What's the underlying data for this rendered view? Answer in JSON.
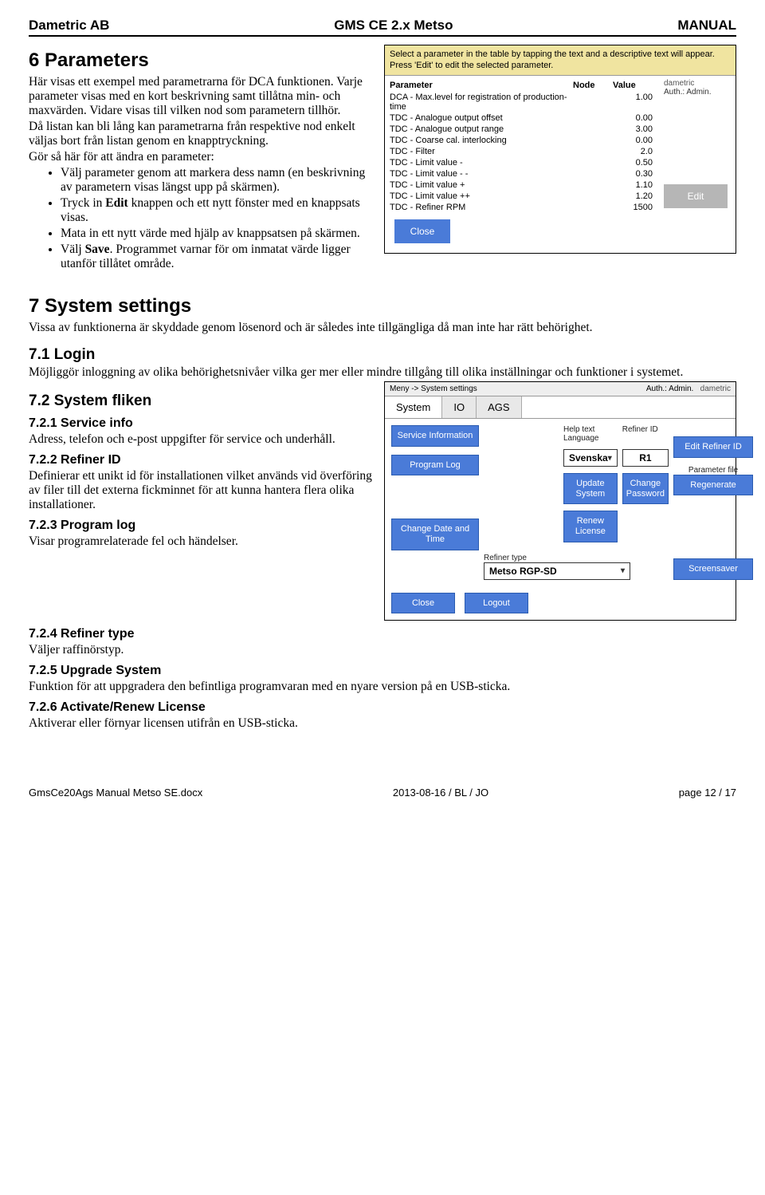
{
  "header": {
    "left": "Dametric AB",
    "center": "GMS CE 2.x Metso",
    "right": "MANUAL"
  },
  "sec6": {
    "title": "6   Parameters",
    "p1": "Här visas ett exempel med parametrarna för DCA funktionen. Varje parameter visas med en kort beskrivning samt tillåtna min- och maxvärden. Vidare visas till vilken nod som parametern tillhör.",
    "p2": "Då listan kan bli lång kan parametrarna från respektive nod enkelt väljas bort från listan genom en knapptryckning.",
    "p3": "Gör så här för att ändra en parameter:",
    "b1": "Välj parameter genom att markera dess namn (en beskrivning av parametern visas längst upp på skärmen).",
    "b2a": "Tryck in ",
    "b2b": "Edit",
    "b2c": " knappen och ett nytt fönster med en knappsats visas.",
    "b3": "Mata in ett nytt värde med hjälp av knappsatsen på skärmen.",
    "b4a": "Välj ",
    "b4b": "Save",
    "b4c": ". Programmet varnar för om inmatat värde ligger utanför tillåtet område."
  },
  "shot1": {
    "hdr1": "Select a parameter in the table by tapping the text and a descriptive text will appear.",
    "hdr2": "Press 'Edit' to edit the selected parameter.",
    "th_param": "Parameter",
    "th_node": "Node",
    "th_value": "Value",
    "brand_a": "dametric",
    "auth": "Auth.: Admin.",
    "edit": "Edit",
    "close": "Close",
    "rows": [
      {
        "p": "DCA - Max.level for registration of production-time",
        "v": "1.00"
      },
      {
        "p": "TDC - Analogue output offset",
        "v": "0.00"
      },
      {
        "p": "TDC - Analogue output range",
        "v": "3.00"
      },
      {
        "p": "TDC - Coarse cal. interlocking",
        "v": "0.00"
      },
      {
        "p": "TDC - Filter",
        "v": "2.0"
      },
      {
        "p": "TDC - Limit value -",
        "v": "0.50"
      },
      {
        "p": "TDC - Limit value - -",
        "v": "0.30"
      },
      {
        "p": "TDC - Limit value +",
        "v": "1.10"
      },
      {
        "p": "TDC - Limit value ++",
        "v": "1.20"
      },
      {
        "p": "TDC - Refiner RPM",
        "v": "1500"
      }
    ]
  },
  "sec7": {
    "title": "7   System settings",
    "p1": "Vissa av funktionerna är skyddade genom lösenord och är således inte tillgängliga då man inte har rätt behörighet.",
    "s71_h": "7.1   Login",
    "s71_p": "Möjliggör inloggning av olika behörighetsnivåer vilka ger mer eller mindre tillgång till olika inställningar och funktioner i systemet.",
    "s72_h": "7.2   System fliken",
    "s721_h": "7.2.1   Service info",
    "s721_p": "Adress, telefon och e-post uppgifter för service och underhåll.",
    "s722_h": "7.2.2   Refiner ID",
    "s722_p": "Definierar ett unikt id för installationen vilket används vid överföring av filer till det externa fickminnet för att kunna hantera flera olika installationer.",
    "s723_h": "7.2.3   Program log",
    "s723_p": "Visar programrelaterade fel och händelser.",
    "s724_h": "7.2.4   Refiner type",
    "s724_p": "Väljer raffinörstyp.",
    "s725_h": "7.2.5   Upgrade System",
    "s725_p": "Funktion för att uppgradera den befintliga programvaran med en nyare version på en USB-sticka.",
    "s726_h": "7.2.6   Activate/Renew License",
    "s726_p": "Aktiverar eller förnyar licensen utifrån en USB-sticka."
  },
  "shot2": {
    "breadcrumb": "Meny -> System settings",
    "auth": "Auth.: Admin.",
    "brand": "dametric",
    "tab_system": "System",
    "tab_io": "IO",
    "tab_ags": "AGS",
    "btn_service": "Service Information",
    "btn_proglog": "Program Log",
    "btn_changedate": "Change Date and Time",
    "lbl_helplang": "Help text  Language",
    "val_lang": "Svenska",
    "lbl_refid": "Refiner ID",
    "val_refid": "R1",
    "btn_editref": "Edit Refiner ID",
    "btn_update": "Update System",
    "btn_changepw": "Change Password",
    "btn_renew": "Renew License",
    "lbl_paramfile": "Parameter file",
    "btn_regen": "Regenerate",
    "lbl_reftype": "Refiner type",
    "val_reftype": "Metso RGP-SD",
    "btn_screensaver": "Screensaver",
    "btn_close": "Close",
    "btn_logout": "Logout"
  },
  "footer": {
    "left": "GmsCe20Ags Manual Metso SE.docx",
    "center": "2013-08-16 / BL / JO",
    "right": "page 12 / 17"
  }
}
